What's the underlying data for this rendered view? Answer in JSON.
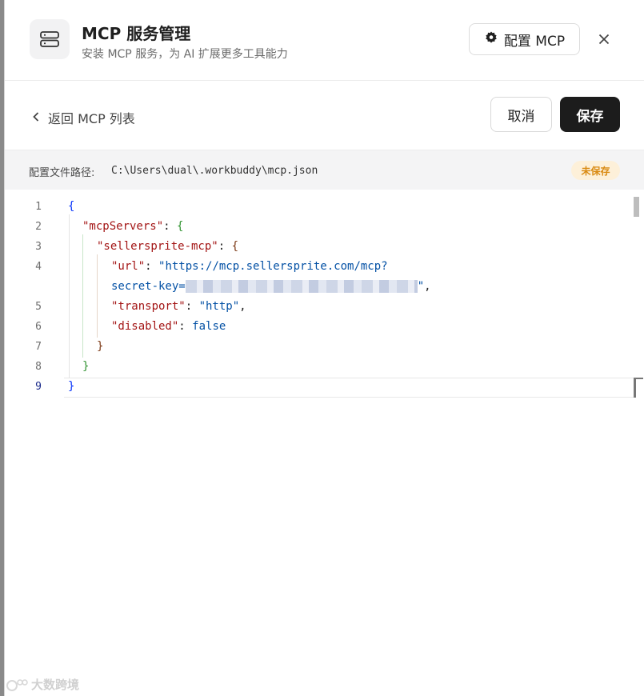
{
  "header": {
    "title": "MCP 服务管理",
    "subtitle": "安装 MCP 服务，为 AI 扩展更多工具能力",
    "config_button": "配置 MCP",
    "server_icon": "server-icon",
    "gear_icon": "gear-icon",
    "close_icon": "close-icon"
  },
  "toolbar": {
    "back_label": "返回 MCP 列表",
    "cancel_label": "取消",
    "save_label": "保存"
  },
  "pathbar": {
    "label": "配置文件路径:",
    "path": "C:\\Users\\dual\\.workbuddy\\mcp.json",
    "status_badge": "未保存",
    "badge_color": "#d98a12"
  },
  "editor": {
    "line_numbers": [
      "1",
      "2",
      "3",
      "4",
      "5",
      "6",
      "7",
      "8",
      "9"
    ],
    "active_line": "9",
    "key_mcpServers": "\"mcpServers\"",
    "key_server": "\"sellersprite-mcp\"",
    "key_url": "\"url\"",
    "url_value_part1": "\"https://mcp.sellersprite.com/mcp?",
    "url_value_part2": "secret-key=",
    "key_transport": "\"transport\"",
    "transport_value": "\"http\"",
    "key_disabled": "\"disabled\"",
    "disabled_value": "false"
  },
  "watermark": "大数跨境"
}
